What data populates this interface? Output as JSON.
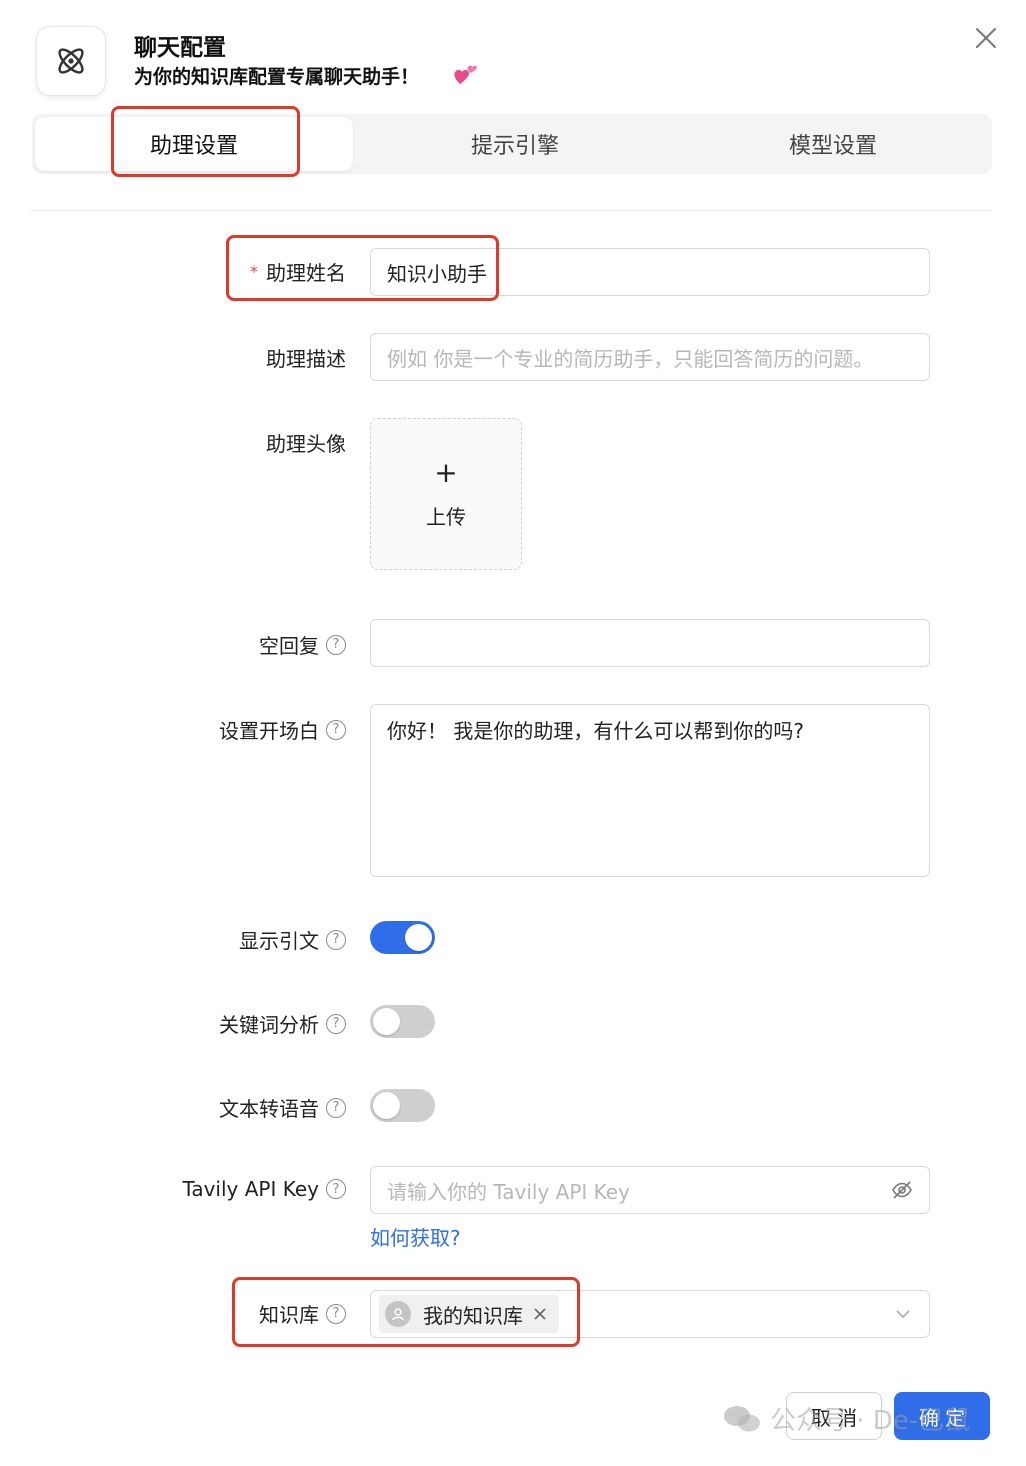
{
  "header": {
    "title": "聊天配置",
    "subtitle": "为你的知识库配置专属聊天助手！",
    "emoji": "💕"
  },
  "tabs": [
    {
      "label": "助理设置",
      "active": true
    },
    {
      "label": "提示引擎",
      "active": false
    },
    {
      "label": "模型设置",
      "active": false
    }
  ],
  "form": {
    "name": {
      "label": "助理姓名",
      "required_mark": "*",
      "value": "知识小助手"
    },
    "description": {
      "label": "助理描述",
      "placeholder": "例如 你是一个专业的简历助手，只能回答简历的问题。"
    },
    "avatar": {
      "label": "助理头像",
      "upload_plus": "+",
      "upload_text": "上传"
    },
    "empty_reply": {
      "label": "空回复",
      "value": ""
    },
    "opener": {
      "label": "设置开场白",
      "value": "你好！ 我是你的助理，有什么可以帮到你的吗?"
    },
    "show_quote": {
      "label": "显示引文",
      "on": true
    },
    "keyword_analysis": {
      "label": "关键词分析",
      "on": false
    },
    "tts": {
      "label": "文本转语音",
      "on": false
    },
    "tavily": {
      "label": "Tavily API Key",
      "placeholder": "请输入你的 Tavily API Key",
      "link": "如何获取?"
    },
    "knowledge_base": {
      "label": "知识库",
      "tag": "我的知识库"
    }
  },
  "help_glyph": "?",
  "footer": {
    "cancel": "取 消",
    "ok": "确 定"
  },
  "watermark": "公众号 · De-已鼠",
  "colors": {
    "accent": "#2f6ee8",
    "annotation": "#e0392b"
  }
}
